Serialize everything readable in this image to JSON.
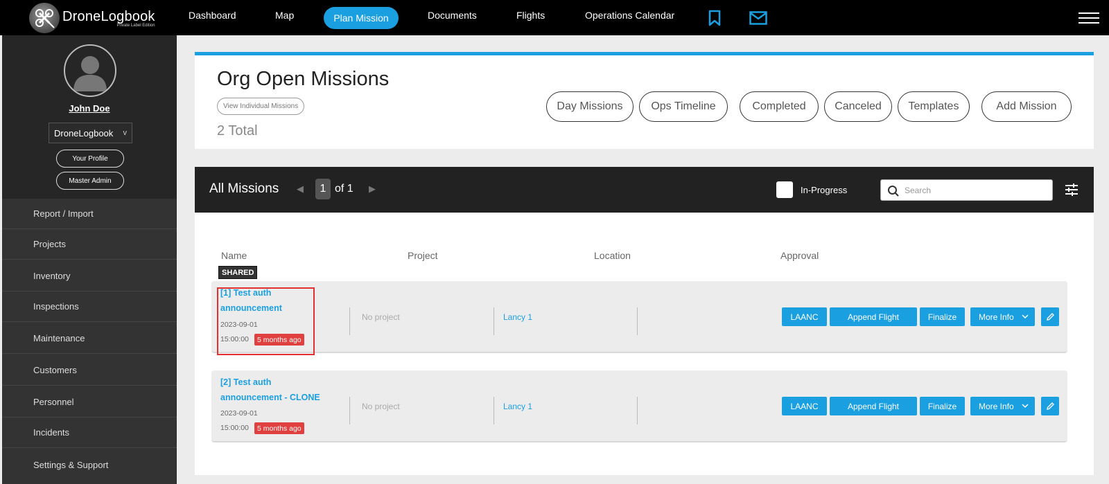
{
  "brand": {
    "name": "DroneLogbook",
    "subtitle": "Private Label Edition"
  },
  "nav": {
    "dashboard": "Dashboard",
    "map": "Map",
    "plan_mission": "Plan Mission",
    "documents": "Documents",
    "flights": "Flights",
    "operations_calendar": "Operations Calendar"
  },
  "icons": {
    "bookmark": "bookmark-icon",
    "mail": "mail-icon",
    "menu": "hamburger-menu-icon",
    "search": "search-icon",
    "filters": "sliders-icon",
    "edit": "pencil-icon"
  },
  "colors": {
    "accent": "#1a9fe0",
    "badge_red": "#e04040",
    "highlight": "#e03030"
  },
  "sidebar": {
    "user_name": "John Doe",
    "org": "DroneLogbook",
    "org_chevron": "v",
    "your_profile": "Your Profile",
    "master_admin": "Master Admin",
    "items": [
      {
        "label": "Report / Import"
      },
      {
        "label": "Projects"
      },
      {
        "label": "Inventory"
      },
      {
        "label": "Inspections"
      },
      {
        "label": "Maintenance"
      },
      {
        "label": "Customers"
      },
      {
        "label": "Personnel"
      },
      {
        "label": "Incidents"
      },
      {
        "label": "Settings & Support"
      }
    ]
  },
  "header": {
    "title": "Org Open Missions",
    "view_individual": "View Individual Missions",
    "total": "2 Total",
    "buttons": {
      "day_missions": "Day Missions",
      "ops_timeline": "Ops Timeline",
      "completed": "Completed",
      "canceled": "Canceled",
      "templates": "Templates",
      "add_mission": "Add Mission"
    }
  },
  "missions": {
    "title": "All Missions",
    "page": "1",
    "of_pages": "of 1",
    "prev": "◀",
    "next": "▶",
    "in_progress": "In-Progress",
    "search_placeholder": "Search",
    "columns": {
      "name": "Name",
      "project": "Project",
      "location": "Location",
      "approval": "Approval"
    },
    "shared_label": "SHARED",
    "rows": [
      {
        "name": "[1] Test auth announcement",
        "date": "2023-09-01",
        "time": "15:00:00",
        "ago": "5 months ago",
        "project": "No project",
        "location": "Lancy 1",
        "actions": {
          "laanc": "LAANC",
          "append": "Append Flight",
          "finalize": "Finalize",
          "more": "More Info"
        }
      },
      {
        "name": "[2] Test auth announcement - CLONE",
        "date": "2023-09-01",
        "time": "15:00:00",
        "ago": "5 months ago",
        "project": "No project",
        "location": "Lancy 1",
        "actions": {
          "laanc": "LAANC",
          "append": "Append Flight",
          "finalize": "Finalize",
          "more": "More Info"
        }
      }
    ]
  }
}
